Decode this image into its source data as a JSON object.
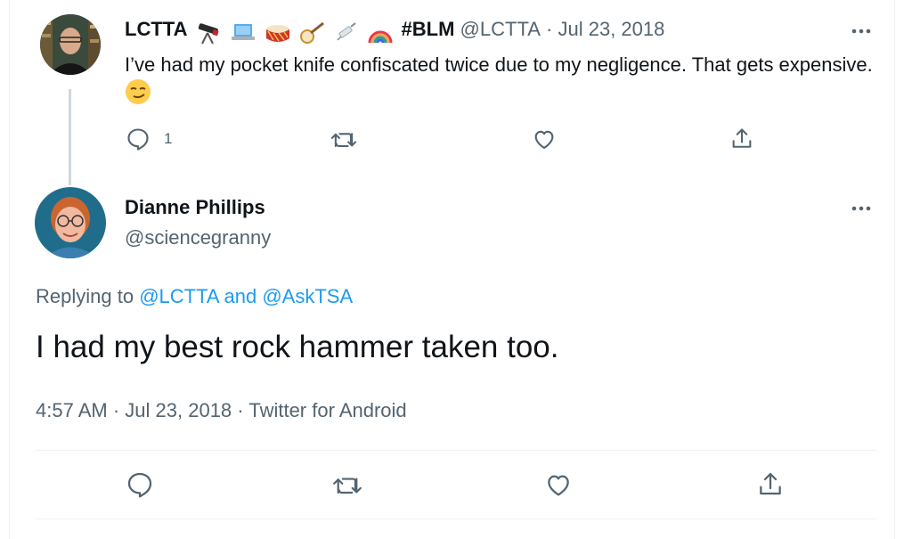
{
  "tweet1": {
    "display_name": "LCTTA",
    "name_emojis": [
      "telescope-emoji",
      "laptop-emoji",
      "drum-emoji",
      "banjo-emoji",
      "syringe-emoji",
      "rainbow-emoji"
    ],
    "name_hashtag": "#BLM",
    "handle": "@LCTTA",
    "separator": "·",
    "date": "Jul 23, 2018",
    "text": "I’ve had my pocket knife confiscated twice due to my negligence. That gets expensive.",
    "text_emoji": "smirking-face-emoji",
    "reply_count": "1",
    "icons": [
      "reply-icon",
      "retweet-icon",
      "like-icon",
      "share-icon",
      "more-icon"
    ]
  },
  "tweet2": {
    "display_name": "Dianne Phillips",
    "handle": "@sciencegranny",
    "replying_prefix": "Replying to",
    "replying_user1": "@LCTTA",
    "replying_and": "and",
    "replying_user2": "@AskTSA",
    "text": "I had my best rock hammer taken too.",
    "time": "4:57 AM",
    "separator": "·",
    "date": "Jul 23, 2018",
    "source": "Twitter for Android",
    "icons": [
      "reply-icon",
      "retweet-icon",
      "like-icon",
      "share-icon",
      "more-icon"
    ]
  },
  "colors": {
    "text": "#0f1419",
    "muted": "#536471",
    "link": "#1d9bf0",
    "thread_line": "#cfd9de",
    "divider": "#eff3f4"
  }
}
